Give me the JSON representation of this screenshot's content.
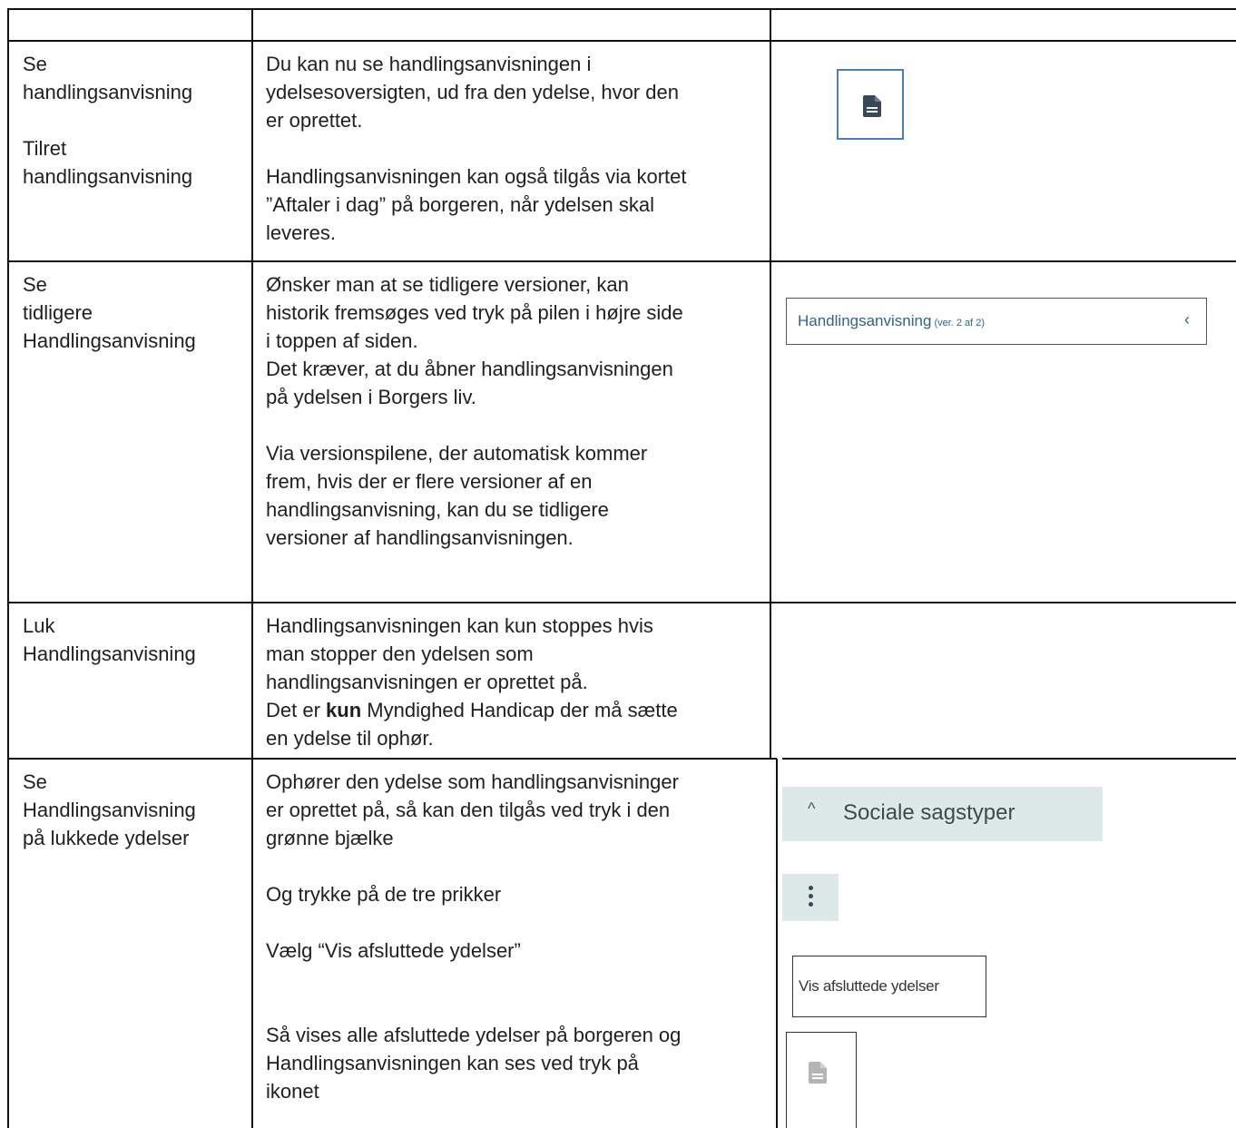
{
  "rows": [
    {
      "heading": [
        "Se",
        "handlingsanvisning"
      ],
      "heading2": [
        "Tilret",
        "handlingsanvisning"
      ],
      "body_lines": [
        "Du kan nu se handlingsanvisningen i",
        "ydelsesoversigten, ud fra den ydelse, hvor den",
        "er oprettet."
      ],
      "body_lines_2": [
        "Handlingsanvisningen kan også tilgås via kortet",
        "”Aftaler i dag” på borgeren, når ydelsen skal",
        "leveres."
      ],
      "icon": "document-icon"
    },
    {
      "heading": [
        "Se",
        "tidligere",
        "Handlingsanvisning"
      ],
      "body_lines": [
        "Ønsker man at se tidligere versioner, kan",
        "historik fremsøges ved tryk på pilen i højre side",
        "i toppen af siden.",
        "Det kræver, at du åbner handlingsanvisningen",
        "på ydelsen i Borgers liv."
      ],
      "body_lines_2": [
        "Via versionspilene, der automatisk kommer",
        "frem, hvis der er flere versioner af en",
        "handlingsanvisning, kan du se tidligere",
        "versioner af handlingsanvisningen."
      ],
      "version_bar": {
        "title": "Handlingsanvisning",
        "version": "(ver. 2 af 2)",
        "chevron": "‹",
        "icon": "chevron-left-icon"
      }
    },
    {
      "heading": [
        "Luk",
        "Handlingsanvisning"
      ],
      "body_lines": [
        "Handlingsanvisningen kan kun stoppes hvis",
        "man stopper den ydelsen som",
        "handlingsanvisningen er oprettet på."
      ],
      "body_bold_line": {
        "before": "Det er ",
        "bold": "kun",
        "after": " Myndighed Handicap der må sætte"
      },
      "body_last_line": "en ydelse til ophør."
    },
    {
      "heading": [
        "Se",
        "Handlingsanvisning",
        "på lukkede ydelser"
      ],
      "body_lines": [
        "Ophører den ydelse som handlingsanvisninger",
        "er oprettet på, så kan den tilgås ved tryk i den",
        "grønne bjælke"
      ],
      "body_line_dots": "Og trykke på de tre prikker",
      "body_line_select": "Vælg “Vis afsluttede ydelser”",
      "body_lines_end": [
        "Så vises alle afsluttede ydelser på borgeren og",
        "Handlingsanvisningen kan ses ved tryk på",
        "ikonet"
      ],
      "social_bar": {
        "caret": "^",
        "label": "Sociale sagstyper",
        "icon": "caret-up-icon"
      },
      "dots_icon": "more-vertical-icon",
      "vis_button": {
        "label": "Vis afsluttede ydelser"
      },
      "doc_icon_grey": "document-icon"
    }
  ],
  "colors": {
    "border": "#111111",
    "doc_icon": "#35495a",
    "doc_btn_border": "#4f7fb0",
    "link_blue": "#2f6589",
    "green_bar": "#dce9e8",
    "grey_icon": "#b5b5b5"
  }
}
